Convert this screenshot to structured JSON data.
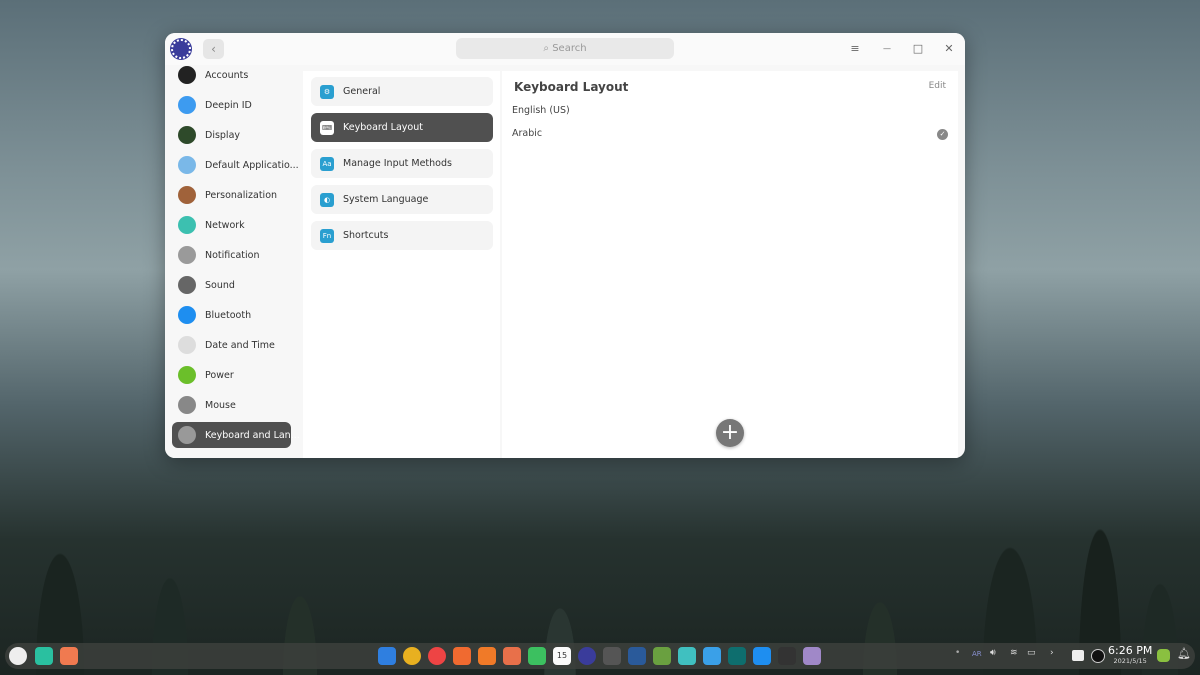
{
  "window": {
    "search_placeholder": "Search",
    "back": "‹",
    "menu": "≡",
    "minimize": "—",
    "maximize": "□",
    "close": "✕"
  },
  "sidebar": {
    "items": [
      {
        "label": "Accounts",
        "color": "#222"
      },
      {
        "label": "Deepin ID",
        "color": "#3d9bf0"
      },
      {
        "label": "Display",
        "color": "#2e4a2a"
      },
      {
        "label": "Default Applicatio...",
        "color": "#7ab8e8"
      },
      {
        "label": "Personalization",
        "color": "#a0623a"
      },
      {
        "label": "Network",
        "color": "#3cc0b0"
      },
      {
        "label": "Notification",
        "color": "#9a9a9a"
      },
      {
        "label": "Sound",
        "color": "#666"
      },
      {
        "label": "Bluetooth",
        "color": "#1e8ef0"
      },
      {
        "label": "Date and Time",
        "color": "#ddd"
      },
      {
        "label": "Power",
        "color": "#6bbf2a"
      },
      {
        "label": "Mouse",
        "color": "#888"
      },
      {
        "label": "Keyboard and Lan...",
        "color": "#999"
      }
    ]
  },
  "middle": {
    "items": [
      {
        "label": "General",
        "icon": "⚙"
      },
      {
        "label": "Keyboard Layout",
        "icon": "⌨"
      },
      {
        "label": "Manage Input Methods",
        "icon": "Aa"
      },
      {
        "label": "System Language",
        "icon": "◐"
      },
      {
        "label": "Shortcuts",
        "icon": "Fn"
      }
    ]
  },
  "main": {
    "title": "Keyboard Layout",
    "edit": "Edit",
    "layouts": [
      "English (US)",
      "Arabic"
    ],
    "check": "✓",
    "add": "+"
  },
  "taskbar": {
    "lang": "AR",
    "time": "6:26 PM",
    "date": "2021/5/15",
    "calendar_day": "15",
    "apps": [
      "#2f7fe0",
      "#e8b020",
      "#e44",
      "#f06a30",
      "#f07a28",
      "#e8704a",
      "#3cc060",
      "#fafafa",
      "#3a3c9b",
      "#555",
      "#2a5a9a",
      "#6aa040",
      "#40c0c0",
      "#3aa0e8",
      "#0e6e6e",
      "#1e8ef0",
      "#333",
      "#a088c8"
    ]
  }
}
